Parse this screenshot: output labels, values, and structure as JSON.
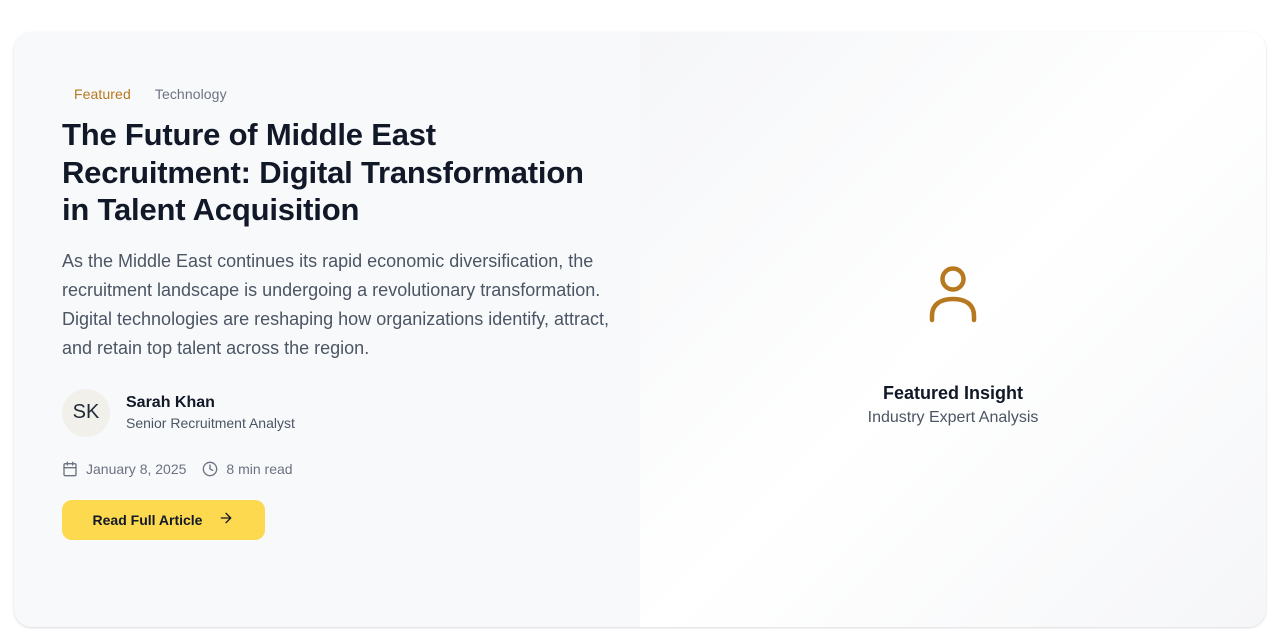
{
  "tags": {
    "featured": "Featured",
    "category": "Technology"
  },
  "article": {
    "title": "The Future of Middle East Recruitment: Digital Transformation in Talent Acquisition",
    "excerpt": "As the Middle East continues its rapid economic diversification, the recruitment landscape is undergoing a revolutionary transformation. Digital technologies are reshaping how organizations identify, attract, and retain top talent across the region.",
    "date": "January 8, 2025",
    "read_time": "8 min read",
    "cta_label": "Read Full Article"
  },
  "author": {
    "initials": "SK",
    "name": "Sarah Khan",
    "role": "Senior Recruitment Analyst"
  },
  "insight": {
    "icon": "user-icon",
    "title": "Featured Insight",
    "subtitle": "Industry Expert Analysis"
  },
  "colors": {
    "accent": "#b7791f",
    "cta_background": "#fcd94f",
    "heading": "#111827",
    "body_text": "#4b5563"
  },
  "icons": {
    "date": "calendar-icon",
    "read_time": "clock-icon",
    "cta": "arrow-right-icon"
  }
}
